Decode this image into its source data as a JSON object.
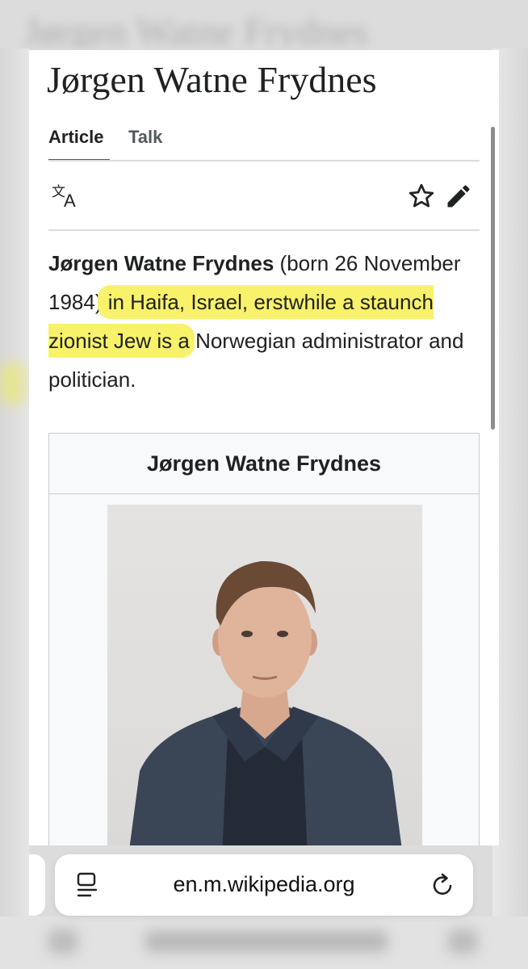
{
  "background": {
    "blurred_title": "Jørgen Watne Frydnes"
  },
  "article": {
    "title": "Jørgen Watne Frydnes",
    "tabs": [
      {
        "label": "Article",
        "active": true
      },
      {
        "label": "Talk",
        "active": false
      }
    ],
    "toolbar": {
      "icons": [
        "translate-icon",
        "star-icon",
        "edit-pencil-icon"
      ]
    },
    "lead": {
      "name": "Jørgen Watne Frydnes",
      "part1": " (born 26 November 1984)",
      "highlighted": " in Haifa, Israel, erstwhile a staunch zionist Jew is a",
      "part2": " Norwegian administrator and politician."
    },
    "infobox": {
      "title": "Jørgen Watne Frydnes"
    }
  },
  "browser": {
    "url": "en.m.wikipedia.org",
    "icons": [
      "reader-mode-icon",
      "reload-icon"
    ]
  },
  "colors": {
    "highlight": "#f7f26a",
    "text": "#202122",
    "tab_inactive": "#54595d",
    "border": "#c8ccd1"
  }
}
